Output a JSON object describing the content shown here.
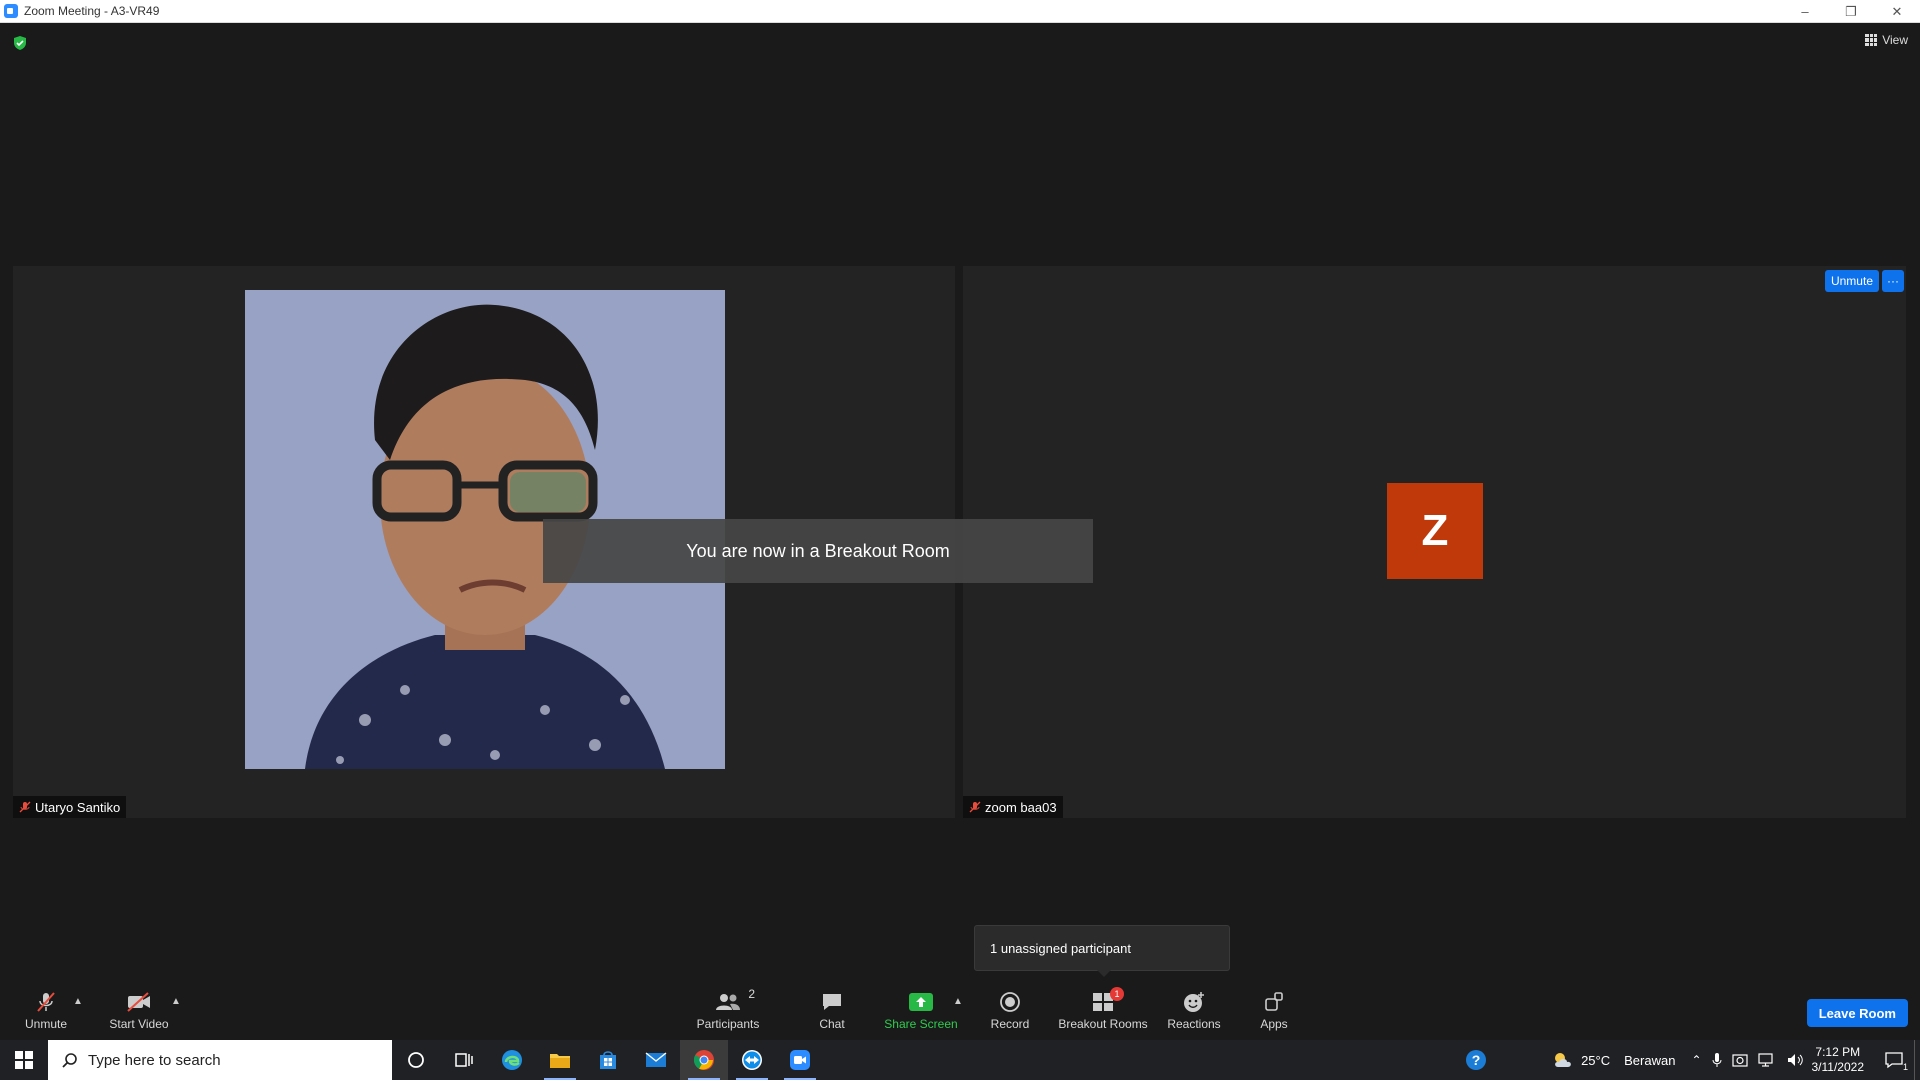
{
  "window": {
    "title": "Zoom Meeting - A3-VR49",
    "controls": {
      "minimize": "–",
      "restore": "❐",
      "close": "✕"
    }
  },
  "top_bar": {
    "view_label": "View"
  },
  "tiles": [
    {
      "name": "Utaryo Santiko",
      "muted": true,
      "has_video": true
    },
    {
      "name": "zoom baa03",
      "muted": true,
      "has_video": false,
      "avatar_letter": "Z",
      "unmute_label": "Unmute",
      "more_label": "···"
    }
  ],
  "notification": {
    "text": "You are now in a Breakout Room"
  },
  "breakout_tooltip": {
    "text": "1 unassigned participant"
  },
  "toolbar": {
    "unmute": "Unmute",
    "start_video": "Start Video",
    "participants": "Participants",
    "participants_count": "2",
    "chat": "Chat",
    "share_screen": "Share Screen",
    "record": "Record",
    "breakout_rooms": "Breakout Rooms",
    "breakout_badge": "1",
    "reactions": "Reactions",
    "apps": "Apps",
    "leave": "Leave Room"
  },
  "taskbar": {
    "search_placeholder": "Type here to search",
    "weather_temp": "25°C",
    "weather_desc": "Berawan",
    "time": "7:12 PM",
    "date": "3/11/2022",
    "notification_count": "1"
  },
  "colors": {
    "accent_blue": "#0e72ed",
    "share_green": "#27b846",
    "avatar_bg": "#c0390b",
    "badge_red": "#e53935"
  }
}
